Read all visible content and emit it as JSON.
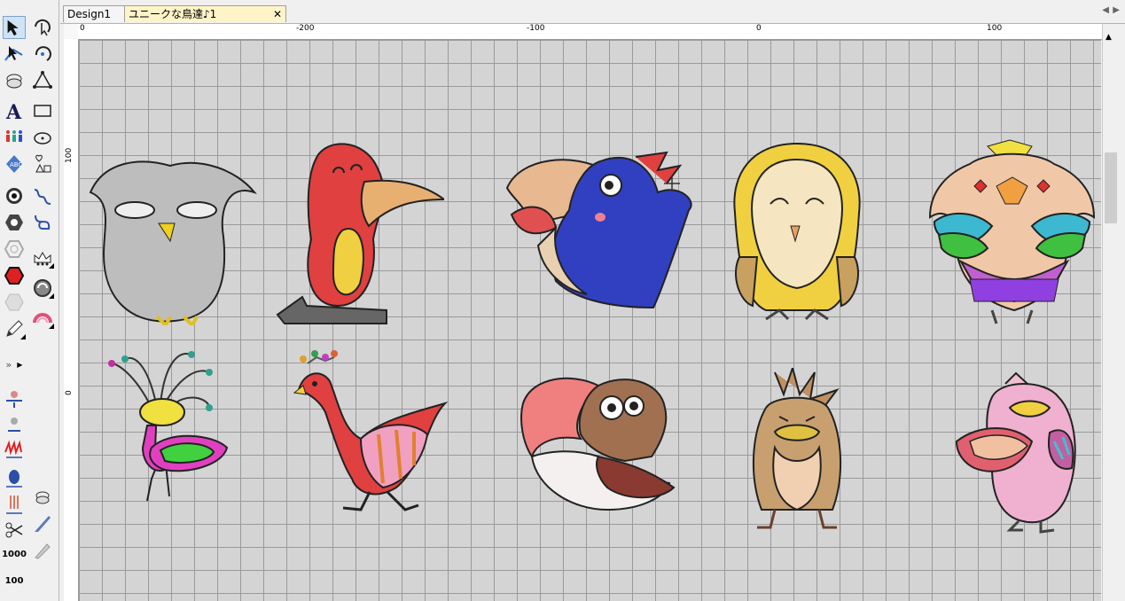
{
  "tabs": [
    {
      "label": "Design1"
    },
    {
      "label": "ユニークな鳥達♪1",
      "close": "✕"
    }
  ],
  "ruler": {
    "top": [
      "0",
      "-200",
      "-100",
      "0",
      "100"
    ],
    "left": [
      "100",
      "0"
    ]
  },
  "icons": [
    "arrow-select-icon",
    "node-edit-icon",
    "stitch-icon",
    "text-icon",
    "people-icon",
    "shape-badge-icon",
    "circle-target-icon",
    "hexagon-icon",
    "hexagon-outline-icon",
    "stop-hexagon-icon",
    "gray-hexagon-icon",
    "pencil-icon"
  ],
  "labels": {
    "n1000": "1000",
    "n100": "100"
  }
}
